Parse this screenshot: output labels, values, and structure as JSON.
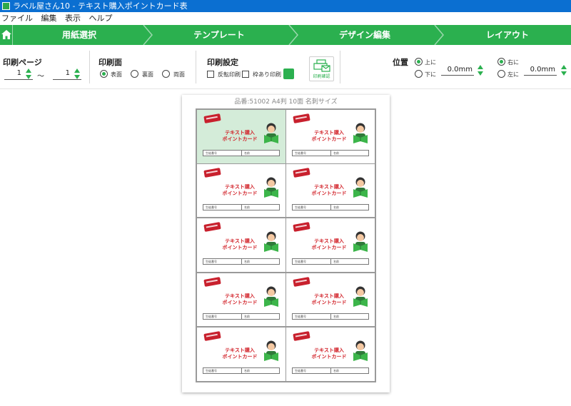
{
  "window": {
    "title": "ラベル屋さん10 - テキスト購入ポイントカード表"
  },
  "menu": {
    "items": [
      "ファイル",
      "編集",
      "表示",
      "ヘルプ"
    ]
  },
  "steps": {
    "items": [
      "用紙選択",
      "テンプレート",
      "デザイン編集",
      "レイアウト"
    ],
    "accent": "#2bb04f"
  },
  "toolbar": {
    "print_pages": {
      "title": "印刷ページ",
      "from": "1",
      "to": "1",
      "tilde": "～"
    },
    "print_side": {
      "title": "印刷面",
      "options": [
        "表面",
        "裏面",
        "両面"
      ],
      "selected": "表面"
    },
    "print_settings": {
      "title": "印刷設定",
      "checkboxes": [
        "反転印刷",
        "枠あり印刷"
      ],
      "print_button_label": "印刷確認"
    },
    "position": {
      "title": "位置",
      "vertical_options": [
        "上に",
        "下に"
      ],
      "vertical_selected": "上に",
      "vertical_value": "0.0mm",
      "horizontal_options": [
        "右に",
        "左に"
      ],
      "horizontal_selected": "右に",
      "horizontal_value": "0.0mm"
    }
  },
  "paper": {
    "title": "品番:51002 A4判 10面 名刺サイズ",
    "card": {
      "line1": "テキスト購入",
      "line2": "ポイントカード",
      "field1": "生徒番号",
      "field2": "名前"
    },
    "card_count": 10,
    "selected_card": 1
  }
}
